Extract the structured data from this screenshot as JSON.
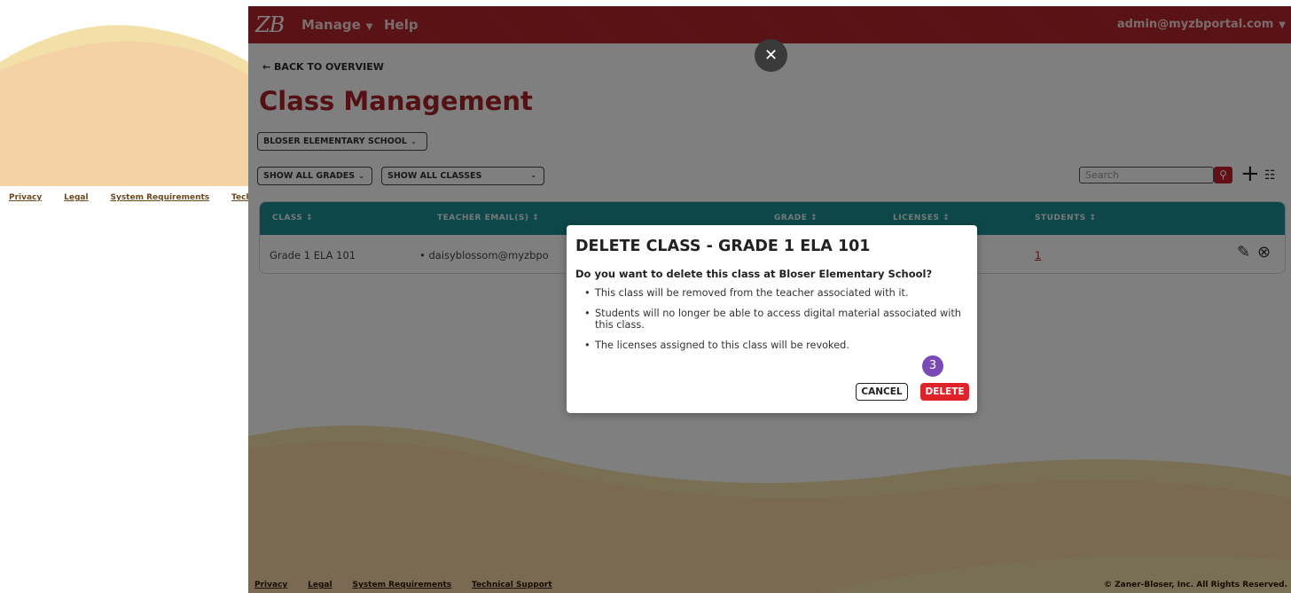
{
  "left_footer": {
    "links": [
      "Privacy",
      "Legal",
      "System Requirements",
      "Tech"
    ]
  },
  "header": {
    "logo": "ZB",
    "nav": [
      {
        "label": "Manage",
        "icon": "caret-down-icon"
      },
      {
        "label": "Help"
      }
    ],
    "user": "admin@myzbportal.com"
  },
  "page": {
    "back_link": "← BACK TO OVERVIEW",
    "title": "Class Management",
    "school_select": "BLOSER ELEMENTARY SCHOOL",
    "grades_select": "SHOW ALL GRADES",
    "classes_select": "SHOW ALL CLASSES",
    "search_placeholder": "Search"
  },
  "table": {
    "headers": [
      "CLASS ↕",
      "TEACHER EMAIL(S) ↕",
      "GRADE ↕",
      "LICENSES ↕",
      "STUDENTS ↕"
    ],
    "rows": [
      {
        "class": "Grade 1 ELA 101",
        "teacher": "•  daisyblossom@myzbpo",
        "students": "1"
      }
    ]
  },
  "modal": {
    "title": "DELETE CLASS - GRADE 1 ELA 101",
    "question": "Do you want to delete this class at Bloser Elementary School?",
    "bullets": [
      "This class will be removed from the teacher associated with it.",
      "Students will no longer be able to access digital material associated with this class.",
      "The licenses assigned to this class will be revoked."
    ],
    "step_badge": "3",
    "cancel_label": "CANCEL",
    "delete_label": "DELETE"
  },
  "footer": {
    "links": [
      "Privacy",
      "Legal",
      "System Requirements",
      "Technical Support"
    ],
    "copyright": "© Zaner-Bloser, Inc. All Rights Reserved."
  },
  "colors": {
    "brand_red": "#b8272c",
    "table_header": "#1c8e94",
    "delete_red": "#e0232b",
    "step_badge": "#7a4bb4"
  }
}
